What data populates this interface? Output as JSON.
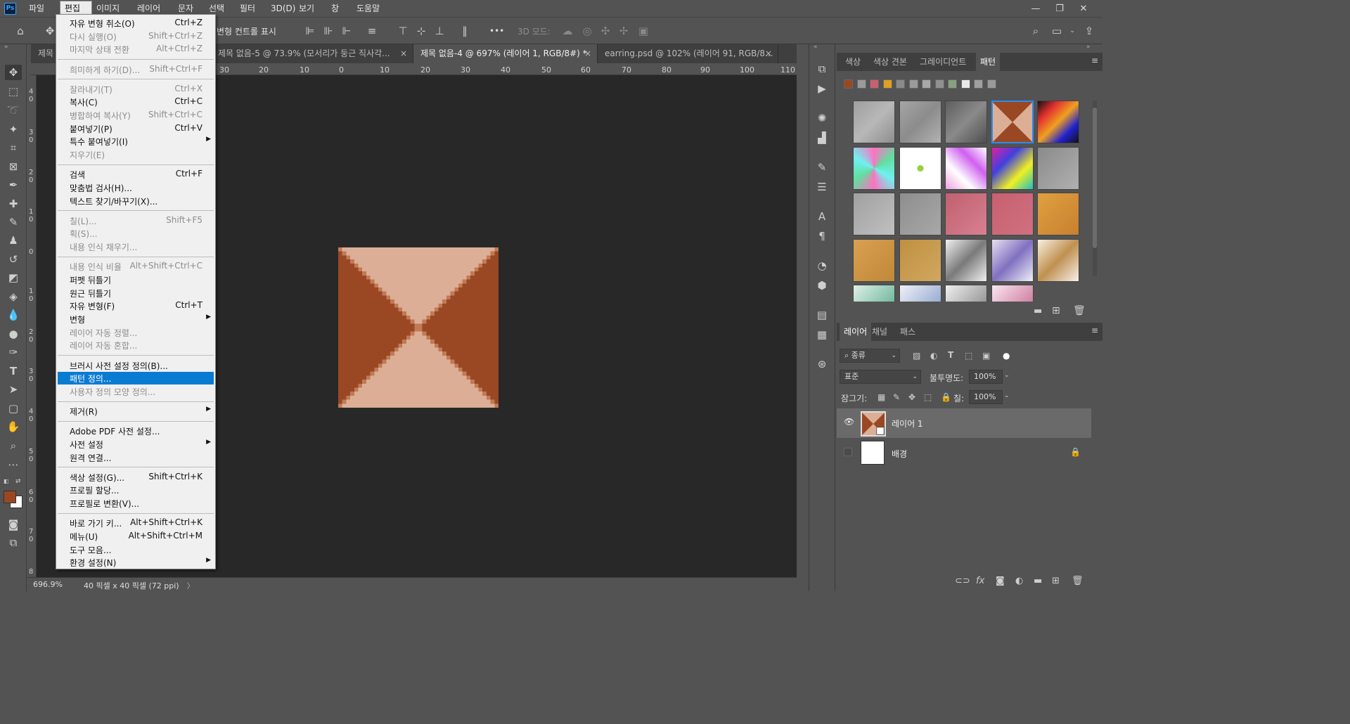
{
  "app": {
    "logo": "Ps"
  },
  "menubar": {
    "items": [
      "파일(F)",
      "편집(E)",
      "이미지(I)",
      "레이어(L)",
      "문자(Y)",
      "선택(S)",
      "필터(T)",
      "3D(D)",
      "보기(V)",
      "창(W)",
      "도움말(H)"
    ],
    "active_index": 1
  },
  "window_controls": {
    "minimize": "—",
    "restore": "❐",
    "close": "✕"
  },
  "options_bar": {
    "transform_controls_label": "변형 컨트롤 표시",
    "mode_3d_label": "3D 모드:",
    "more": "•••"
  },
  "tabs": [
    {
      "label": "제목",
      "close": ""
    },
    {
      "label": "제목 없음-5 @ 73.9% (모서리가 둥근 직사각...",
      "close": "×"
    },
    {
      "label": "제목 없음-4 @ 697% (레이어 1, RGB/8#) *",
      "close": "×"
    },
    {
      "label": "earring.psd @ 102% (레이어 91, RGB/8...",
      "close": "×"
    }
  ],
  "ruler": {
    "top_ticks": [
      "30",
      "20",
      "10",
      "0",
      "10",
      "20",
      "30",
      "40",
      "50",
      "60",
      "70",
      "80",
      "90",
      "100",
      "110"
    ],
    "left_ticks": [
      "40",
      "30",
      "20",
      "10",
      "0",
      "10",
      "20",
      "30",
      "40",
      "50",
      "60",
      "70",
      "8"
    ]
  },
  "status": {
    "zoom": "696.9%",
    "doc_info": "40 픽셀 x 40 픽셀 (72 ppi)",
    "arrow": "〉"
  },
  "edit_menu": {
    "items": [
      {
        "label": "자유 변형 취소(O)",
        "shortcut": "Ctrl+Z",
        "enabled": true
      },
      {
        "label": "다시 실행(O)",
        "shortcut": "Shift+Ctrl+Z",
        "enabled": false
      },
      {
        "label": "마지막 상태 전환",
        "shortcut": "Alt+Ctrl+Z",
        "enabled": false
      },
      {
        "label": "희미하게 하기(D)...",
        "shortcut": "Shift+Ctrl+F",
        "enabled": false
      },
      {
        "label": "잘라내기(T)",
        "shortcut": "Ctrl+X",
        "enabled": false
      },
      {
        "label": "복사(C)",
        "shortcut": "Ctrl+C",
        "enabled": true
      },
      {
        "label": "병합하여 복사(Y)",
        "shortcut": "Shift+Ctrl+C",
        "enabled": false
      },
      {
        "label": "붙여넣기(P)",
        "shortcut": "Ctrl+V",
        "enabled": true
      },
      {
        "label": "특수 붙여넣기(I)",
        "shortcut": "",
        "enabled": true,
        "submenu": true
      },
      {
        "label": "지우기(E)",
        "shortcut": "",
        "enabled": false
      },
      {
        "label": "검색",
        "shortcut": "Ctrl+F",
        "enabled": true
      },
      {
        "label": "맞춤법 검사(H)...",
        "shortcut": "",
        "enabled": true
      },
      {
        "label": "텍스트 찾기/바꾸기(X)...",
        "shortcut": "",
        "enabled": true
      },
      {
        "label": "칠(L)...",
        "shortcut": "Shift+F5",
        "enabled": false
      },
      {
        "label": "획(S)...",
        "shortcut": "",
        "enabled": false
      },
      {
        "label": "내용 인식 채우기...",
        "shortcut": "",
        "enabled": false
      },
      {
        "label": "내용 인식 비율",
        "shortcut": "Alt+Shift+Ctrl+C",
        "enabled": false
      },
      {
        "label": "퍼펫 뒤틀기",
        "shortcut": "",
        "enabled": true
      },
      {
        "label": "원근 뒤틀기",
        "shortcut": "",
        "enabled": true
      },
      {
        "label": "자유 변형(F)",
        "shortcut": "Ctrl+T",
        "enabled": true
      },
      {
        "label": "변형",
        "shortcut": "",
        "enabled": true,
        "submenu": true
      },
      {
        "label": "레이어 자동 정렬...",
        "shortcut": "",
        "enabled": false
      },
      {
        "label": "레이어 자동 혼합...",
        "shortcut": "",
        "enabled": false
      },
      {
        "label": "브러시 사전 설정 정의(B)...",
        "shortcut": "",
        "enabled": true
      },
      {
        "label": "패턴 정의...",
        "shortcut": "",
        "enabled": true,
        "highlighted": true
      },
      {
        "label": "사용자 정의 모양 정의...",
        "shortcut": "",
        "enabled": false
      },
      {
        "label": "제거(R)",
        "shortcut": "",
        "enabled": true,
        "submenu": true
      },
      {
        "label": "Adobe PDF 사전 설정...",
        "shortcut": "",
        "enabled": true
      },
      {
        "label": "사전 설정",
        "shortcut": "",
        "enabled": true,
        "submenu": true
      },
      {
        "label": "원격 연결...",
        "shortcut": "",
        "enabled": true
      },
      {
        "label": "색상 설정(G)...",
        "shortcut": "Shift+Ctrl+K",
        "enabled": true
      },
      {
        "label": "프로필 할당...",
        "shortcut": "",
        "enabled": true
      },
      {
        "label": "프로필로 변환(V)...",
        "shortcut": "",
        "enabled": true
      },
      {
        "label": "바로 가기 키...",
        "shortcut": "Alt+Shift+Ctrl+K",
        "enabled": true
      },
      {
        "label": "메뉴(U)",
        "shortcut": "Alt+Shift+Ctrl+M",
        "enabled": true
      },
      {
        "label": "도구 모음...",
        "shortcut": "",
        "enabled": true
      },
      {
        "label": "환경 설정(N)",
        "shortcut": "",
        "enabled": true,
        "submenu": true
      }
    ]
  },
  "panels_top": {
    "tabs": [
      "색상",
      "색상 견본",
      "그레이디언트",
      "패턴"
    ],
    "active": "패턴"
  },
  "panels_layers": {
    "tabs": [
      "레이어",
      "채널",
      "패스"
    ],
    "filter_label": "종류",
    "blend_mode": "표준",
    "opacity_label": "불투명도:",
    "opacity_value": "100%",
    "lock_label": "잠그기:",
    "fill_label": "칠:",
    "fill_value": "100%",
    "layers": [
      {
        "name": "레이어 1",
        "visible": true,
        "selected": true
      },
      {
        "name": "배경",
        "visible": false,
        "selected": false,
        "locked": true
      }
    ]
  },
  "colors": {
    "pattern_dark": "#9a4823",
    "pattern_light": "#dcae96",
    "foreground": "#9a4823",
    "background": "#ffffff",
    "menu_highlight": "#0a7bd3"
  }
}
